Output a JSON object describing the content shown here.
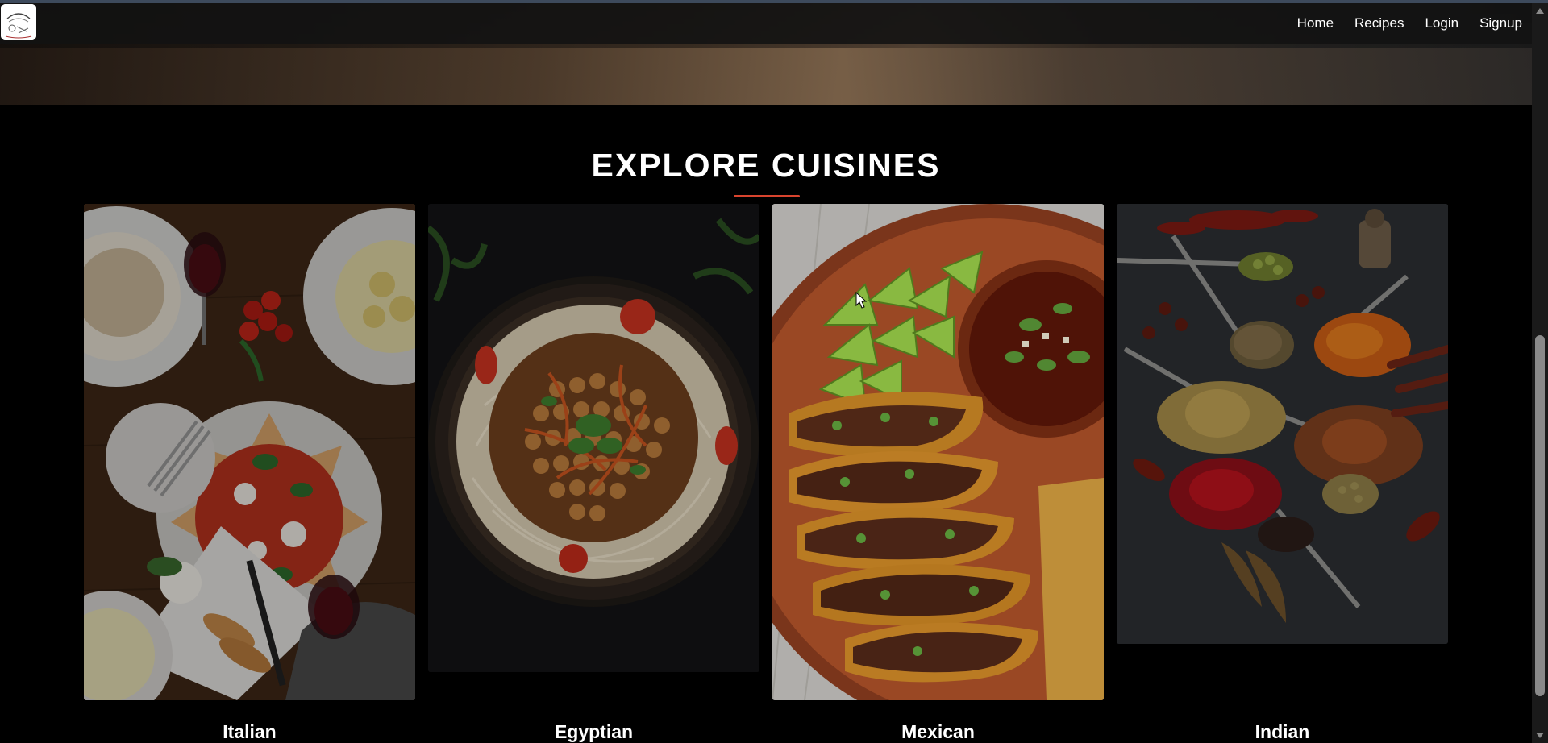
{
  "nav": {
    "links": [
      "Home",
      "Recipes",
      "Login",
      "Signup"
    ]
  },
  "section": {
    "title": "EXPLORE CUISINES",
    "accent_color": "#d9442e"
  },
  "cuisines": [
    {
      "name": "Italian",
      "image": "italian-food-photo"
    },
    {
      "name": "Egyptian",
      "image": "egyptian-koshari-photo"
    },
    {
      "name": "Mexican",
      "image": "mexican-tacos-photo"
    },
    {
      "name": "Indian",
      "image": "indian-spices-photo"
    }
  ],
  "icons": {
    "logo": "site-logo",
    "cursor": "mouse-pointer-icon"
  }
}
